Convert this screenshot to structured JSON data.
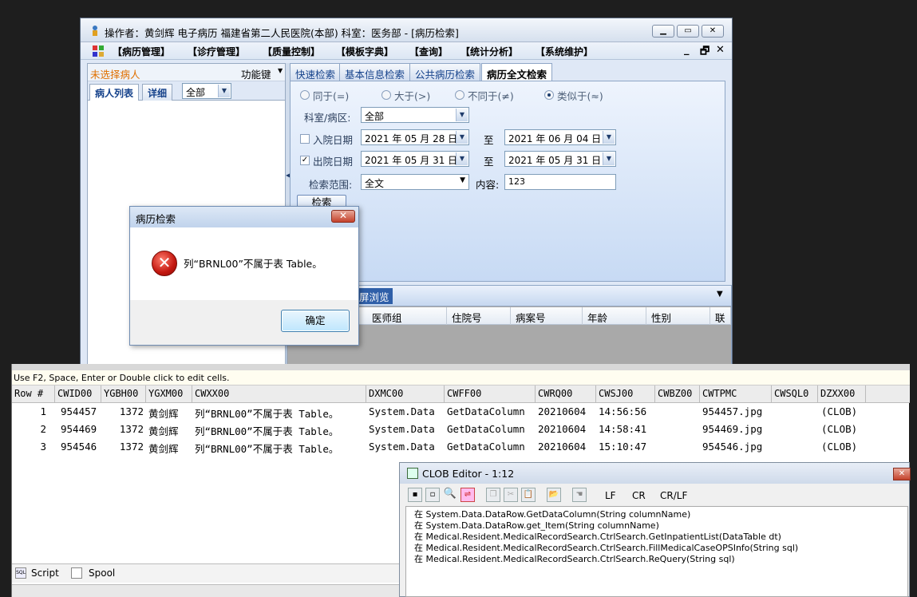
{
  "main_window": {
    "title": "操作者：黄剑辉 电子病历  福建省第二人民医院(本部)  科室：医务部 - [病历检索]",
    "menu": [
      "【病历管理】",
      "【诊疗管理】",
      "【质量控制】",
      "【模板字典】",
      "【查询】",
      "【统计分析】",
      "【系统维护】"
    ],
    "mdi_buttons": [
      "_",
      "🗗",
      "✕"
    ]
  },
  "left_panel": {
    "no_patient": "未选择病人",
    "function_key": "功能键",
    "tabs": [
      "病人列表",
      "详细"
    ],
    "filter_value": "全部"
  },
  "search_tabs": [
    "快速检索",
    "基本信息检索",
    "公共病历检索",
    "病历全文检索"
  ],
  "search_form": {
    "radios": [
      {
        "label": "同于(=)",
        "selected": false
      },
      {
        "label": "大于(>)",
        "selected": false
      },
      {
        "label": "不同于(≠)",
        "selected": false
      },
      {
        "label": "类似于(≈)",
        "selected": true
      }
    ],
    "dept_label": "科室/病区:",
    "dept_value": "全部",
    "admit_label": "入院日期",
    "admit_checked": false,
    "admit_from": "2021 年 05 月 28 日",
    "admit_to": "2021 年 06 月 04 日",
    "discharge_label": "出院日期",
    "discharge_checked": true,
    "discharge_from": "2021 年 05 月 31 日",
    "discharge_to": "2021 年 05 月 31 日",
    "to_label": "至",
    "scope_label": "检索范围:",
    "scope_value": "全文",
    "content_label": "内容:",
    "content_value": "123",
    "search_button": "检索"
  },
  "result_grid": {
    "bar_partial": "屏浏览",
    "columns": [
      "医师组",
      "住院号",
      "病案号",
      "年龄",
      "性别",
      "联"
    ]
  },
  "error_dialog": {
    "title": "病历检索",
    "message": "列“BRNL00”不属于表 Table。",
    "ok": "确定"
  },
  "sql_results": {
    "hint": "Use F2, Space, Enter or Double click to edit cells.",
    "columns": [
      "Row #",
      "CWID00",
      "YGBH00",
      "YGXM00",
      "CWXX00",
      "DXMC00",
      "CWFF00",
      "CWRQ00",
      "CWSJ00",
      "CWBZ00",
      "CWTPMC",
      "CWSQL0",
      "DZXX00"
    ],
    "rows": [
      [
        "1",
        "954457",
        "1372",
        "黄剑辉",
        "列“BRNL00”不属于表 Table。",
        "System.Data",
        "GetDataColumn",
        "20210604",
        "14:56:56",
        "",
        "954457.jpg",
        "",
        "(CLOB)"
      ],
      [
        "2",
        "954469",
        "1372",
        "黄剑辉",
        "列“BRNL00”不属于表 Table。",
        "System.Data",
        "GetDataColumn",
        "20210604",
        "14:58:41",
        "",
        "954469.jpg",
        "",
        "(CLOB)"
      ],
      [
        "3",
        "954546",
        "1372",
        "黄剑辉",
        "列“BRNL00”不属于表 Table。",
        "System.Data",
        "GetDataColumn",
        "20210604",
        "15:10:47",
        "",
        "954546.jpg",
        "",
        "(CLOB)"
      ]
    ],
    "tab_script": "Script",
    "tab_spool": "Spool"
  },
  "clob_editor": {
    "title": "CLOB Editor - 1:12",
    "line_end_options": [
      {
        "label": "LF",
        "selected": false
      },
      {
        "label": "CR",
        "selected": false
      },
      {
        "label": "CR/LF",
        "selected": true
      }
    ],
    "lines": [
      "在 System.Data.DataRow.GetDataColumn(String columnName)",
      "在 System.Data.DataRow.get_Item(String columnName)",
      "在 Medical.Resident.MedicalRecordSearch.CtrlSearch.GetInpatientList(DataTable dt)",
      "在 Medical.Resident.MedicalRecordSearch.CtrlSearch.FillMedicalCaseOPSInfo(String sql)",
      "在 Medical.Resident.MedicalRecordSearch.CtrlSearch.ReQuery(String sql)"
    ]
  }
}
